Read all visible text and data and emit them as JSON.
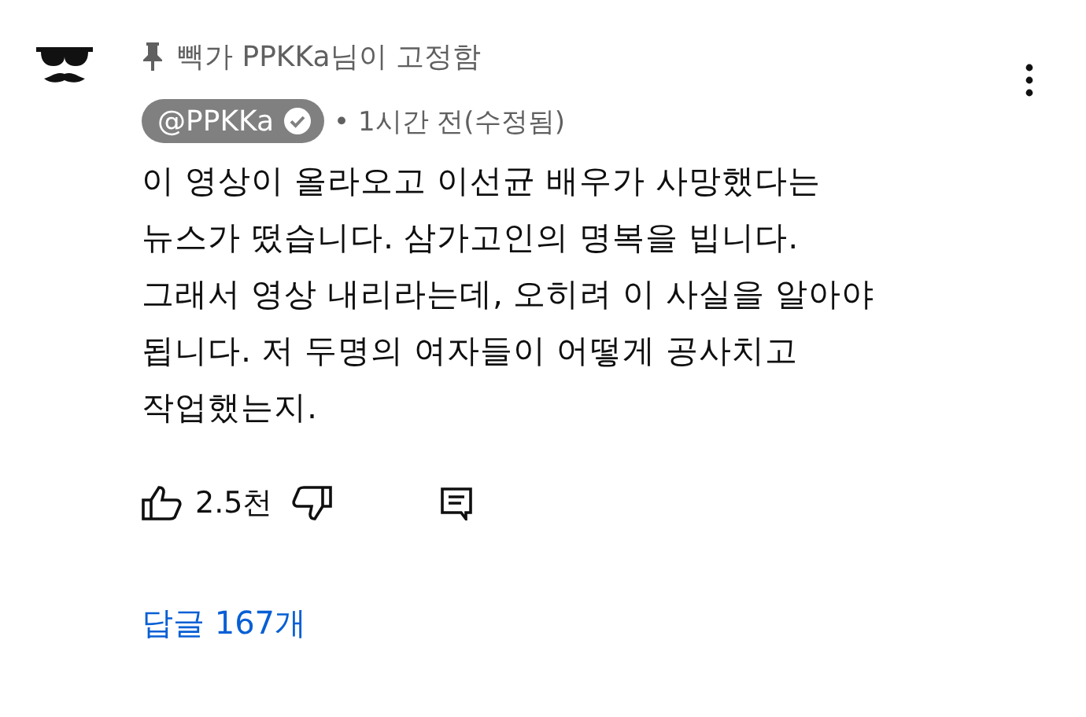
{
  "pinned": {
    "label": "빽가 PPKKa님이 고정함"
  },
  "author": {
    "handle": "@PPKKa",
    "verified": true,
    "meta": "• 1시간 전(수정됨)"
  },
  "body": [
    "이 영상이 올라오고 이선균 배우가 사망했다는",
    "뉴스가 떴습니다. 삼가고인의 명복을 빕니다.",
    "그래서 영상 내리라는데, 오히려 이 사실을 알아야",
    "됩니다. 저 두명의 여자들이 어떻게 공사치고",
    "작업했는지."
  ],
  "actions": {
    "likes": "2.5천"
  },
  "replies": {
    "label": "답글 167개"
  }
}
